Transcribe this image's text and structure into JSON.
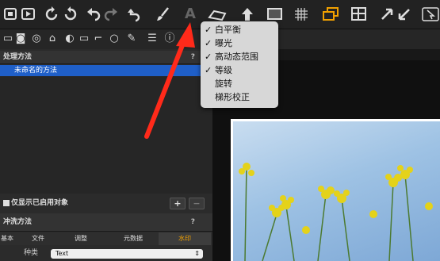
{
  "toolbar": {
    "icons": [
      "camera-import-icon",
      "export-icon",
      "rotate-left-icon",
      "rotate-right-icon",
      "undo-icon",
      "redo-icon",
      "reset-icon",
      "brush-icon",
      "text-icon",
      "keystone-icon",
      "upload-icon",
      "crop-icon",
      "grid-icon",
      "overlay-icon",
      "layout-icon",
      "cursor-icon",
      "arrow-icon",
      "pointer-icon"
    ]
  },
  "process_panel": {
    "title": "处理方法",
    "help": "?",
    "selected_item": "未命名的方法"
  },
  "show_only": {
    "label": "仅显示已启用对象",
    "add": "+",
    "remove": "−"
  },
  "develop_panel": {
    "title": "冲洗方法",
    "help": "?",
    "tabs": [
      {
        "label": "基本",
        "active": false
      },
      {
        "label": "文件",
        "active": false
      },
      {
        "label": "调整",
        "active": false
      },
      {
        "label": "元数据",
        "active": false
      },
      {
        "label": "水印",
        "active": true
      }
    ],
    "kind_label": "种类",
    "kind_value": "Text"
  },
  "dropdown_menu": {
    "items": [
      {
        "label": "白平衡",
        "checked": true
      },
      {
        "label": "曝光",
        "checked": true
      },
      {
        "label": "高动态范围",
        "checked": true
      },
      {
        "label": "等级",
        "checked": true
      },
      {
        "label": "旋转",
        "checked": false
      },
      {
        "label": "梯形校正",
        "checked": false
      }
    ],
    "check_mark": "✓"
  },
  "colors": {
    "accent": "#f0a000",
    "selection": "#1f5fc8",
    "annotation_arrow": "#ff2a1a"
  }
}
